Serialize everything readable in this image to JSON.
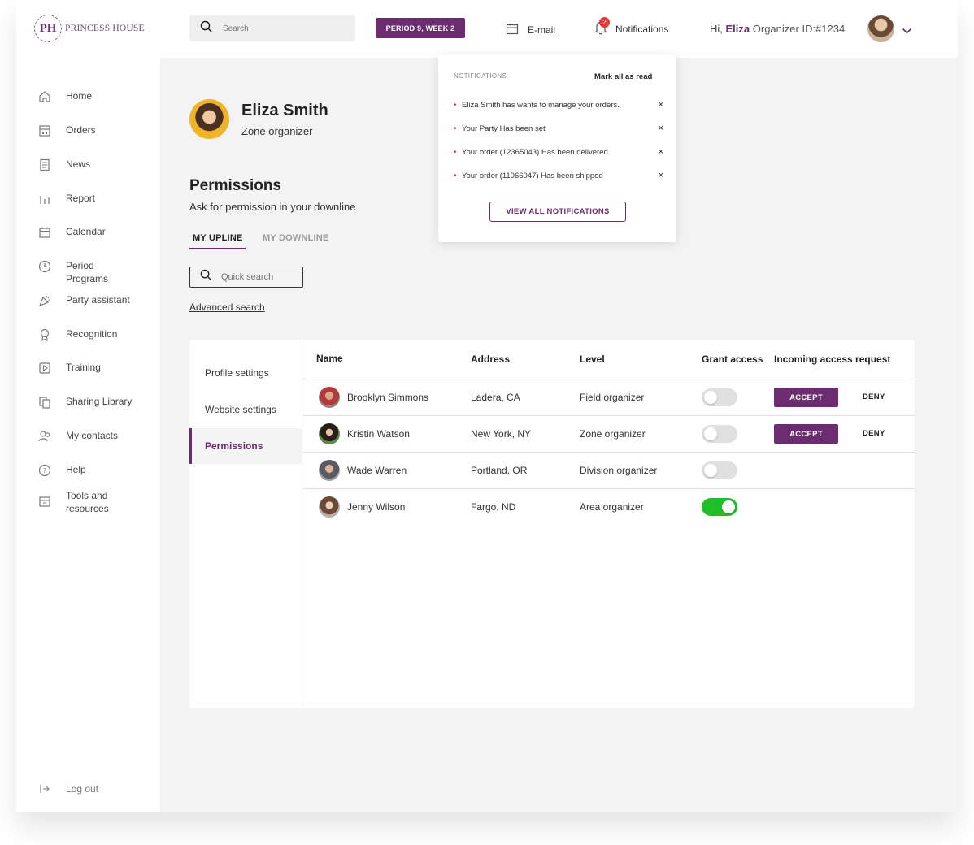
{
  "brand": {
    "logo_initials": "PH",
    "logo_text": "PRINCESS HOUSE"
  },
  "sidebar": {
    "items": [
      {
        "label": "Home",
        "icon": "home-icon"
      },
      {
        "label": "Orders",
        "icon": "orders-icon"
      },
      {
        "label": "News",
        "icon": "news-icon"
      },
      {
        "label": "Report",
        "icon": "report-icon"
      },
      {
        "label": "Calendar",
        "icon": "calendar-icon"
      },
      {
        "label": "Period Programs",
        "icon": "clock-icon"
      },
      {
        "label": "Party assistant",
        "icon": "party-icon"
      },
      {
        "label": "Recognition",
        "icon": "award-icon"
      },
      {
        "label": "Training",
        "icon": "play-icon"
      },
      {
        "label": "Sharing Library",
        "icon": "copy-icon"
      },
      {
        "label": "My contacts",
        "icon": "contacts-icon"
      },
      {
        "label": "Help",
        "icon": "help-icon"
      },
      {
        "label": "Tools and resources",
        "icon": "archive-icon"
      }
    ],
    "logout_label": "Log out"
  },
  "header": {
    "search_placeholder": "Search",
    "period_label": "PERIOD 9, WEEK 2",
    "email_label": "E-mail",
    "notifications_label": "Notifications",
    "notifications_count": "2",
    "greeting_prefix": "Hi,",
    "greeting_name": "Eliza",
    "organizer_id": "Organizer ID:#1234"
  },
  "profile": {
    "name": "Eliza Smith",
    "role": "Zone organizer"
  },
  "permissions": {
    "title": "Permissions",
    "subtitle": "Ask for permission in your downline",
    "tabs": [
      {
        "label": "MY UPLINE"
      },
      {
        "label": "MY DOWNLINE"
      }
    ],
    "quick_search_placeholder": "Quick search",
    "advanced_search_label": "Advanced search"
  },
  "settings_nav": [
    {
      "label": "Profile settings"
    },
    {
      "label": "Website settings"
    },
    {
      "label": "Permissions"
    }
  ],
  "table": {
    "columns": [
      "Name",
      "Address",
      "Level",
      "Grant access",
      "Incoming access request"
    ],
    "rows": [
      {
        "name": "Brooklyn Simmons",
        "address": "Ladera, CA",
        "level": "Field organizer",
        "grant_access": false,
        "request": true
      },
      {
        "name": "Kristin Watson",
        "address": "New York, NY",
        "level": "Zone organizer",
        "grant_access": false,
        "request": true
      },
      {
        "name": "Wade Warren",
        "address": "Portland, OR",
        "level": "Division organizer",
        "grant_access": false,
        "request": false
      },
      {
        "name": "Jenny Wilson",
        "address": "Fargo, ND",
        "level": "Area organizer",
        "grant_access": true,
        "request": false
      }
    ],
    "accept_label": "ACCEPT",
    "deny_label": "DENY"
  },
  "notifications": {
    "title": "NOTIFICATIONS",
    "mark_all_label": "Mark all as read",
    "items": [
      {
        "text": "Eliza Smith has wants to manage your orders."
      },
      {
        "text": "Your Party Has been set"
      },
      {
        "text": "Your order (12365043) Has been delivered"
      },
      {
        "text": "Your order (11066047) Has been shipped"
      }
    ],
    "view_all_label": "VIEW ALL NOTIFICATIONS"
  },
  "colors": {
    "accent": "#6b2d6f",
    "toggle_on": "#1fbf2a",
    "badge": "#e53935"
  }
}
